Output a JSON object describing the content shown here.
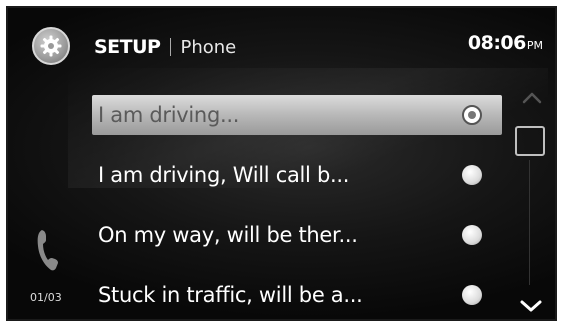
{
  "header": {
    "title": "SETUP",
    "subtitle": "Phone",
    "time": "08:06",
    "ampm": "PM"
  },
  "messages": [
    {
      "label": "I am driving...",
      "selected": true
    },
    {
      "label": "I am driving, Will call b...",
      "selected": false
    },
    {
      "label": "On my way, will be ther...",
      "selected": false
    },
    {
      "label": "Stuck in traffic, will be a...",
      "selected": false
    }
  ],
  "page_counter": "01/03",
  "icons": {
    "settings": "gear-icon",
    "phone": "phone-icon",
    "scroll_up": "chevron-up-icon",
    "scroll_down": "chevron-down-icon"
  }
}
